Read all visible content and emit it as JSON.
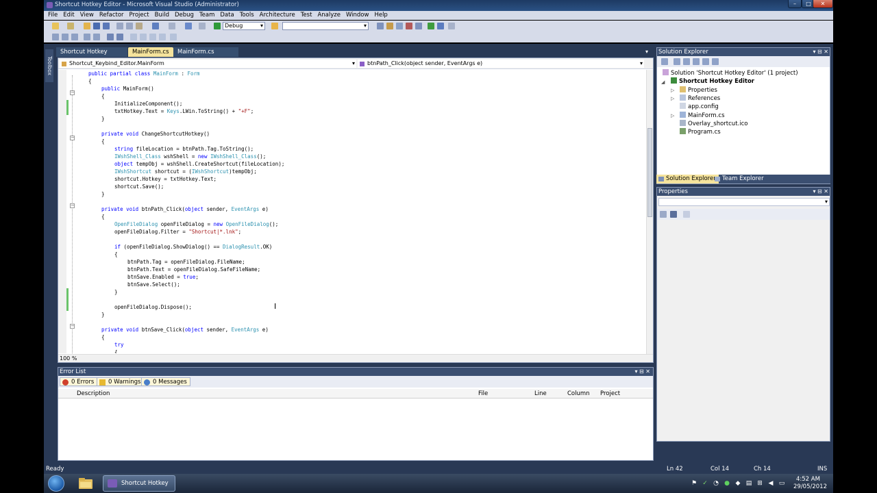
{
  "window": {
    "title": "Shortcut Hotkey Editor - Microsoft Visual Studio (Administrator)",
    "controls": {
      "minimize": "–",
      "maximize": "□",
      "close": "✕"
    }
  },
  "menu": [
    "File",
    "Edit",
    "View",
    "Refactor",
    "Project",
    "Build",
    "Debug",
    "Team",
    "Data",
    "Tools",
    "Architecture",
    "Test",
    "Analyze",
    "Window",
    "Help"
  ],
  "toolbar": {
    "configuration": "Debug",
    "platform": ""
  },
  "toolbox_strip": "Toolbox",
  "doc_tabs": [
    {
      "label": "Shortcut Hotkey Editor",
      "active": false
    },
    {
      "label": "MainForm.cs",
      "active": true
    },
    {
      "label": "MainForm.cs [Design]",
      "active": false
    }
  ],
  "editor": {
    "nav_type": "Shortcut_Keybind_Editor.MainForm",
    "nav_member": "btnPath_Click(object sender, EventArgs e)",
    "zoom": "100 %",
    "lines": [
      "public partial class MainForm : Form",
      "{",
      "public MainForm()",
      "{",
      "InitializeComponent();",
      "txtHotkey.Text = Keys.LWin.ToString() + \"+F\";",
      "}",
      "",
      "private void ChangeShortcutHotkey()",
      "{",
      "string fileLocation = btnPath.Tag.ToString();",
      "IWshShell_Class wshShell = new IWshShell_Class();",
      "object tempObj = wshShell.CreateShortcut(fileLocation);",
      "IWshShortcut shortcut = (IWshShortcut)tempObj;",
      "shortcut.Hotkey = txtHotkey.Text;",
      "shortcut.Save();",
      "}",
      "",
      "private void btnPath_Click(object sender, EventArgs e)",
      "{",
      "OpenFileDialog openFileDialog = new OpenFileDialog();",
      "openFileDialog.Filter = \"Shortcut|*.lnk\";",
      "",
      "if (openFileDialog.ShowDialog() == DialogResult.OK)",
      "{",
      "btnPath.Tag = openFileDialog.FileName;",
      "btnPath.Text = openFileDialog.SafeFileName;",
      "btnSave.Enabled = true;",
      "btnSave.Select();",
      "}",
      "",
      "openFileDialog.Dispose();",
      "}",
      "",
      "private void btnSave_Click(object sender, EventArgs e)",
      "{",
      "try",
      "{"
    ]
  },
  "error_list": {
    "title": "Error List",
    "errors": "0 Errors",
    "warnings": "0 Warnings",
    "messages": "0 Messages",
    "columns": [
      "Description",
      "File",
      "Line",
      "Column",
      "Project"
    ]
  },
  "solution_explorer": {
    "title": "Solution Explorer",
    "items": [
      "Solution 'Shortcut Hotkey Editor' (1 project)",
      "Shortcut Hotkey Editor",
      "Properties",
      "References",
      "app.config",
      "MainForm.cs",
      "Overlay_shortcut.ico",
      "Program.cs"
    ],
    "tabs": [
      "Solution Explorer",
      "Team Explorer"
    ]
  },
  "properties": {
    "title": "Properties"
  },
  "status": {
    "state": "Ready",
    "ln": "Ln 42",
    "col": "Col 14",
    "ch": "Ch 14",
    "mode": "INS"
  },
  "taskbar": {
    "task": "Shortcut Hotkey E...",
    "time": "4:52 AM",
    "date": "29/05/2012"
  },
  "colors": {
    "frame": "#293955",
    "active_tab": "#f5e39c",
    "keyword": "#0000ff",
    "type": "#2b91af",
    "string": "#a31515"
  }
}
